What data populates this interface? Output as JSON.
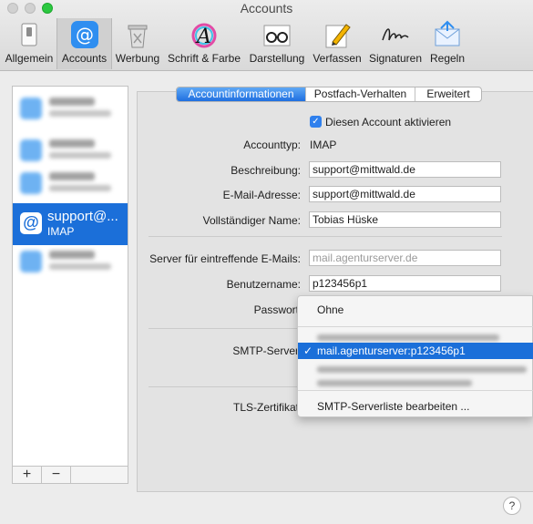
{
  "window": {
    "title": "Accounts"
  },
  "toolbar": [
    {
      "id": "allgemein",
      "label": "Allgemein",
      "icon": "switch-icon"
    },
    {
      "id": "accounts",
      "label": "Accounts",
      "icon": "at-icon",
      "active": true
    },
    {
      "id": "werbung",
      "label": "Werbung",
      "icon": "trash-icon"
    },
    {
      "id": "schrift",
      "label": "Schrift & Farbe",
      "icon": "font-icon"
    },
    {
      "id": "darstellung",
      "label": "Darstellung",
      "icon": "glasses-icon"
    },
    {
      "id": "verfassen",
      "label": "Verfassen",
      "icon": "pencil-icon"
    },
    {
      "id": "signaturen",
      "label": "Signaturen",
      "icon": "signature-icon"
    },
    {
      "id": "regeln",
      "label": "Regeln",
      "icon": "rules-envelope-icon"
    }
  ],
  "accounts": {
    "selected": {
      "name": "support@...",
      "type": "IMAP"
    },
    "footer": {
      "add": "+",
      "remove": "−"
    }
  },
  "tabs": [
    {
      "label": "Accountinformationen",
      "active": true
    },
    {
      "label": "Postfach-Verhalten"
    },
    {
      "label": "Erweitert"
    }
  ],
  "form": {
    "enable_label": "Diesen Account aktivieren",
    "enable_checked": true,
    "accounttyp_label": "Accounttyp:",
    "accounttyp_value": "IMAP",
    "beschreibung_label": "Beschreibung:",
    "beschreibung_value": "support@mittwald.de",
    "email_label": "E-Mail-Adresse:",
    "email_value": "support@mittwald.de",
    "name_label": "Vollständiger Name:",
    "name_value": "Tobias Hüske",
    "incoming_label": "Server für eintreffende E-Mails:",
    "incoming_placeholder": "mail.agenturserver.de",
    "username_label": "Benutzername:",
    "username_value": "p123456p1",
    "password_label": "Passwort",
    "smtp_label": "SMTP-Server",
    "tls_label": "TLS-Zertifikat"
  },
  "smtp_menu": {
    "none": "Ohne",
    "selected": "mail.agenturserver:p123456p1",
    "edit": "SMTP-Serverliste bearbeiten ..."
  },
  "help": "?",
  "colors": {
    "accent": "#1b6fd9",
    "window": "#ececec"
  }
}
